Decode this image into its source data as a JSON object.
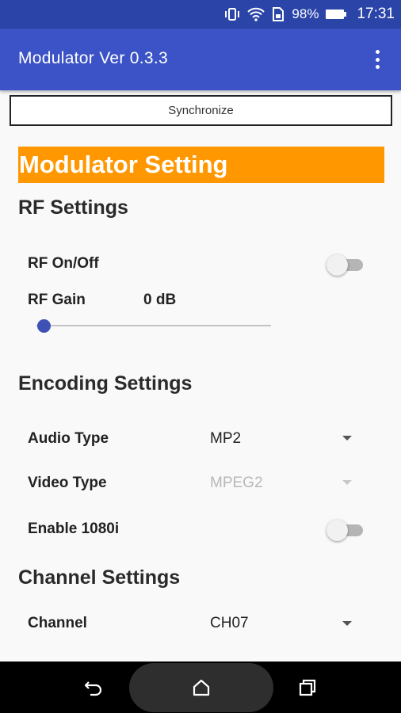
{
  "status_bar": {
    "battery": "98%",
    "time": "17:31",
    "icons": [
      "vibrate-icon",
      "wifi-icon",
      "sim-icon",
      "battery-icon"
    ]
  },
  "app_bar": {
    "title": "Modulator Ver 0.3.3",
    "menu_icon": "overflow-menu-icon"
  },
  "sync_button": {
    "label": "Synchronize"
  },
  "banner": {
    "title": "Modulator Setting",
    "color": "#ff9800"
  },
  "rf_settings": {
    "heading": "RF Settings",
    "rf_onoff": {
      "label": "RF On/Off",
      "on": false
    },
    "rf_gain": {
      "label": "RF Gain",
      "value": "0 dB",
      "level": 0
    }
  },
  "encoding_settings": {
    "heading": "Encoding Settings",
    "audio_type": {
      "label": "Audio Type",
      "value": "MP2"
    },
    "video_type": {
      "label": "Video Type",
      "value": "MPEG2",
      "enabled": false
    },
    "enable_1080i": {
      "label": "Enable 1080i",
      "on": false
    }
  },
  "channel_settings": {
    "heading": "Channel Settings",
    "channel": {
      "label": "Channel",
      "value": "CH07"
    }
  },
  "nav_bar": {
    "icons": [
      "back-icon",
      "home-icon",
      "recents-icon"
    ]
  },
  "colors": {
    "status_bar": "#2a44a8",
    "app_bar": "#3b53c6",
    "accent": "#3f51b5"
  }
}
